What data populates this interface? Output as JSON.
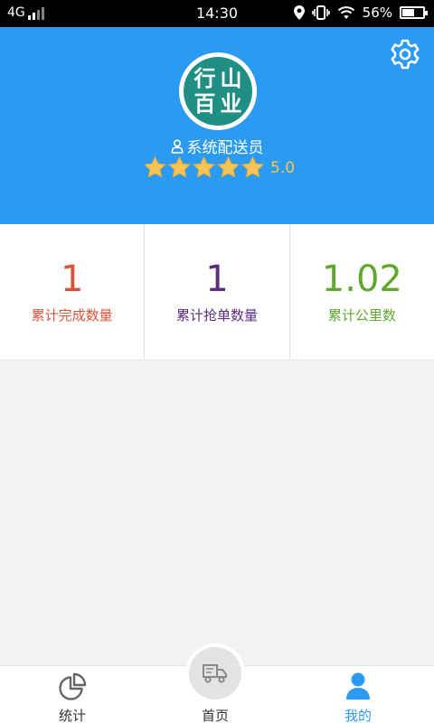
{
  "status_bar": {
    "network": "4G",
    "time": "14:30",
    "battery": "56%",
    "battery_level": 0.56
  },
  "profile": {
    "logo_chars": [
      "行",
      "山",
      "百",
      "业"
    ],
    "role": "系统配送员",
    "rating_stars": 5,
    "rating": "5.0"
  },
  "stats": [
    {
      "value": "1",
      "label": "累计完成数量",
      "color": "#d9533a"
    },
    {
      "value": "1",
      "label": "累计抢单数量",
      "color": "#5b2c7e"
    },
    {
      "value": "1.02",
      "label": "累计公里数",
      "color": "#5fa82e"
    }
  ],
  "tabs": [
    {
      "label": "统计",
      "icon": "pie-chart-icon",
      "active": false
    },
    {
      "label": "首页",
      "icon": "truck-icon",
      "active": false
    },
    {
      "label": "我的",
      "icon": "user-icon",
      "active": true
    }
  ],
  "colors": {
    "header_bg": "#2b9af3",
    "logo_bg": "#1f8f84",
    "star": "#f7c455",
    "active_tab": "#2b9af3"
  }
}
